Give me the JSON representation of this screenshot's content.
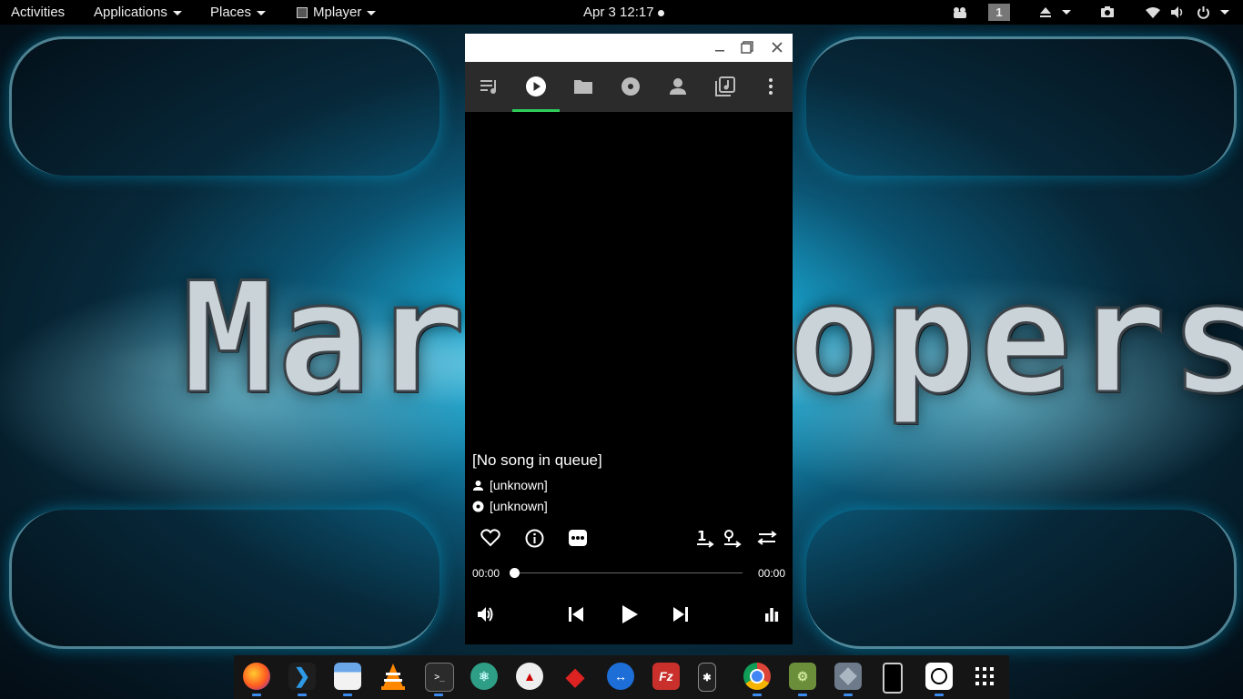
{
  "topbar": {
    "activities": "Activities",
    "applications": "Applications",
    "places": "Places",
    "active_app": "Mplayer",
    "clock": "Apr 3  12:17",
    "workspace": "1"
  },
  "wallpaper": {
    "text_left": "Mart",
    "text_right": "opers"
  },
  "window": {
    "tabs": [
      "queue-icon",
      "now-playing-icon",
      "folder-icon",
      "album-icon",
      "artist-icon",
      "playlist-icon"
    ],
    "song_title": "[No song in queue]",
    "artist": "[unknown]",
    "album": "[unknown]",
    "time_elapsed": "00:00",
    "time_total": "00:00",
    "seek_position": 0,
    "accent_color": "#2ecc5a"
  },
  "dock": {
    "apps": [
      "firefox",
      "vscode",
      "files",
      "vlc",
      "terminal",
      "atom",
      "transmission",
      "gitkraken",
      "teamviewer",
      "filezilla",
      "kde-connect",
      "chrome",
      "android-studio",
      "virtualbox",
      "phone",
      "mplayer",
      "show-apps"
    ]
  }
}
